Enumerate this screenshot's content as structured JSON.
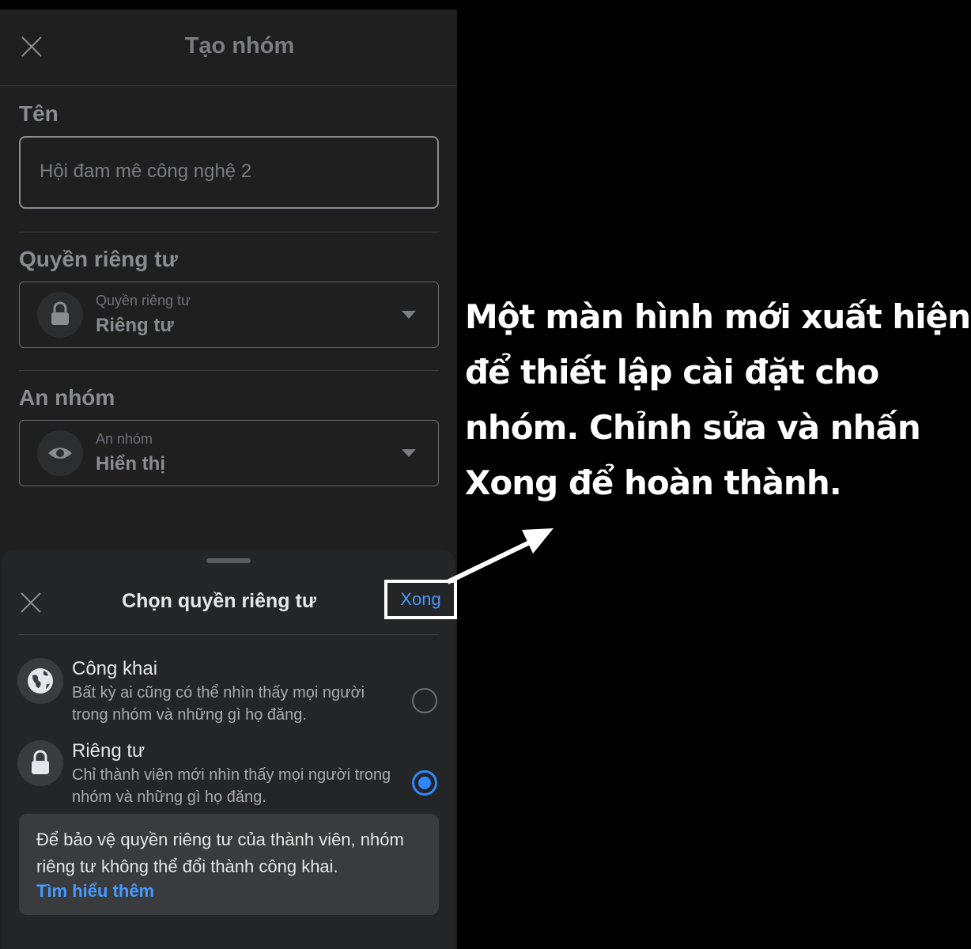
{
  "header": {
    "title": "Tạo nhóm"
  },
  "form": {
    "name_label": "Tên",
    "name_value": "Hội đam mê công nghệ 2",
    "privacy_label": "Quyền riêng tư",
    "privacy_small": "Quyền riêng tư",
    "privacy_value": "Riêng tư",
    "hide_label": "An nhóm",
    "hide_small": "An nhóm",
    "hide_value": "Hiển thị"
  },
  "sheet": {
    "title": "Chọn quyền riêng tư",
    "done_label": "Xong",
    "options": [
      {
        "title": "Công khai",
        "desc": "Bất kỳ ai cũng có thể nhìn thấy mọi người trong nhóm và những gì họ đăng.",
        "selected": false
      },
      {
        "title": "Riêng tư",
        "desc": "Chỉ thành viên mới nhìn thấy mọi người trong nhóm và những gì họ đăng.",
        "selected": true
      }
    ],
    "info_text": "Để bảo vệ quyền riêng tư của thành viên, nhóm riêng tư không thể đổi thành công khai.",
    "info_link": "Tìm hiểu thêm"
  },
  "caption": "Một màn hình mới xuất hiện để thiết lập cài đặt cho nhóm. Chỉnh sửa và nhấn Xong để hoàn thành.",
  "colors": {
    "accent": "#2d88ff",
    "link": "#4599ff",
    "sheet_bg": "#242526",
    "page_bg": "#1f1f20"
  },
  "icons": {
    "close": "close-icon",
    "lock": "lock-icon",
    "eye": "eye-icon",
    "globe": "globe-icon",
    "caret": "caret-down-icon"
  }
}
